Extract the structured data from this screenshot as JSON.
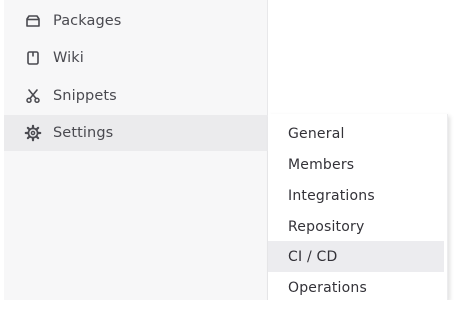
{
  "sidebar": {
    "items": [
      {
        "label": "Packages",
        "icon": "package-icon"
      },
      {
        "label": "Wiki",
        "icon": "book-icon"
      },
      {
        "label": "Snippets",
        "icon": "snippet-icon"
      },
      {
        "label": "Settings",
        "icon": "gear-icon",
        "active": true
      }
    ]
  },
  "flyout": {
    "items": [
      {
        "label": "General"
      },
      {
        "label": "Members"
      },
      {
        "label": "Integrations"
      },
      {
        "label": "Repository"
      },
      {
        "label": "CI / CD",
        "hovered": true
      },
      {
        "label": "Operations"
      }
    ]
  },
  "colors": {
    "sidebar_bg": "#f7f7f8",
    "active_bg": "#ebebed",
    "hover_bg": "#ececef",
    "text": "#333238",
    "icon": "#4a4a50"
  }
}
